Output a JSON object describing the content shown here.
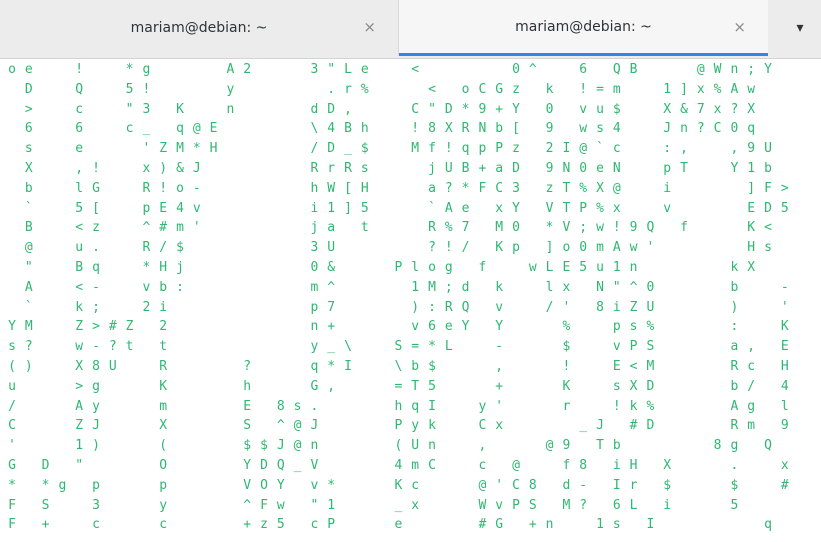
{
  "tabs": [
    {
      "title": "mariam@debian: ~",
      "close": "×"
    },
    {
      "title": "mariam@debian: ~",
      "close": "×"
    }
  ],
  "menu_icon": "▾",
  "terminal": {
    "fg_color": "#2eb872",
    "dim_color": "#c8c8c8",
    "rows": [
      "oe  !  *g    A2   3\"Le  <     0^  6 QB   @Wn;Y",
      " D  Q  5!    y     .r%   < oCGz k !=m  1]x%Aw",
      " >  c  \"3 K  n    dD,   C\"D*9+Y 0 vu$  X&7x?X",
      " 6  6  c_ q@E     \\4Bh  !8XRNb[ 9 ws4  Jn?C0q",
      " s  e   'ZM*H     /D_$  Mf!qpPz 2I@`c  :,  ,9U",
      " X  ,!  x)&J      RrRs   jUB+aD 9N0eN  pT  Y1b",
      " b  lG  R!o-      hW[H   a?*FC3 zT%X@  i    ]F>",
      " `  5[  pE4v      i1]5   `Ae xY VTP%x  v    ED5",
      " B  <z  ^#m'      ja t   R%7 M0 *V;w!9Q f   K<",
      " @  u.  R/$       3U     ?!/ Kp ]o0mAw'     Hs",
      " \"  Bq  *Hj       0&   Plog f  wLE5u1n     kX",
      " A  <-  vb:       m^    1M;d k  lx N\"^0    b  -",
      " `  k;  2i        p7    ):RQ v  /' 8iZU    )  '",
      "YM  Z>#Z 2        n+    v6eY Y   %  ps%    :  K",
      "s?  w-?t t        y_\\  S=*L  -   $  vPS    a, E",
      "()  X8U  R    ?   q*I  \\b$   ,   !  E<M    Rc H",
      "u   >g   K    h   G,   =T5   +   K  sXD    b/ 4",
      "/   Ay   m    E 8s.    hqI  y'   r  !k%    Ag l",
      "C   ZJ   X    S ^@J    Pyk  Cx    _J #D    Rm 9",
      "'   1)   (    $$J@n    (Un  ,   @9 Tb     8g Q",
      "G D \"    O    YDQ_V    4mC  c @  f8 iH X   .  x",
      "* *g p   p    VOY v*   Kc   @'C8 d- Ir $   $  #",
      "F S  3   y    ^Fw \"1   _x   WvPS M? 6L i   5",
      "F +  c   c    +z5 cP   e    #G +n  1s I      q"
    ]
  }
}
